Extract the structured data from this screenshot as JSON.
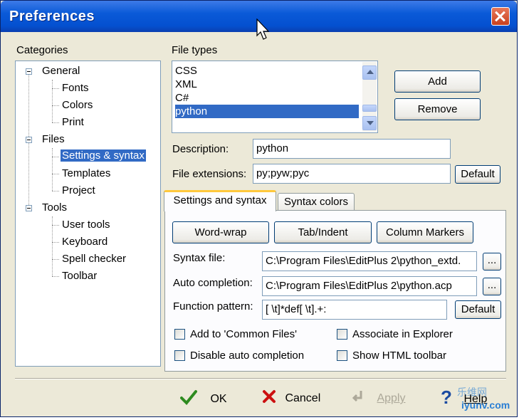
{
  "window": {
    "title": "Preferences"
  },
  "categories": {
    "label": "Categories",
    "tree": [
      {
        "label": "General",
        "children": [
          "Fonts",
          "Colors",
          "Print"
        ]
      },
      {
        "label": "Files",
        "children": [
          "Settings & syntax",
          "Templates",
          "Project"
        ],
        "selected": "Settings & syntax"
      },
      {
        "label": "Tools",
        "children": [
          "User tools",
          "Keyboard",
          "Spell checker",
          "Toolbar"
        ]
      }
    ]
  },
  "file_types": {
    "label": "File types",
    "items": [
      "CSS",
      "XML",
      "C#",
      "python"
    ],
    "selected": "python",
    "add_label": "Add",
    "remove_label": "Remove"
  },
  "description": {
    "label": "Description:",
    "value": "python"
  },
  "file_extensions": {
    "label": "File extensions:",
    "value": "py;pyw;pyc",
    "default_label": "Default"
  },
  "tabs": {
    "active": "Settings and syntax",
    "inactive": "Syntax colors"
  },
  "settings": {
    "word_wrap_label": "Word-wrap",
    "tab_indent_label": "Tab/Indent",
    "column_markers_label": "Column Markers",
    "syntax_file": {
      "label": "Syntax file:",
      "value": "C:\\Program Files\\EditPlus 2\\python_extd.",
      "browse": "..."
    },
    "auto_completion": {
      "label": "Auto completion:",
      "value": "C:\\Program Files\\EditPlus 2\\python.acp",
      "browse": "..."
    },
    "function_pattern": {
      "label": "Function pattern:",
      "value": "[ \\t]*def[ \\t].+:",
      "default_label": "Default"
    },
    "checkboxes": {
      "add_common": "Add to 'Common Files'",
      "associate": "Associate in Explorer",
      "disable_auto": "Disable auto completion",
      "show_html": "Show HTML toolbar"
    }
  },
  "footer": {
    "ok": "OK",
    "cancel": "Cancel",
    "apply": "Apply",
    "help": "Help"
  },
  "watermark": {
    "line1": "乐维网",
    "line2": "iyunv.com"
  },
  "colors": {
    "accent": "#316ac5",
    "titlebar": "#0a5ad8",
    "ok_green": "#2e8b1f",
    "cancel_red": "#cc1010"
  }
}
